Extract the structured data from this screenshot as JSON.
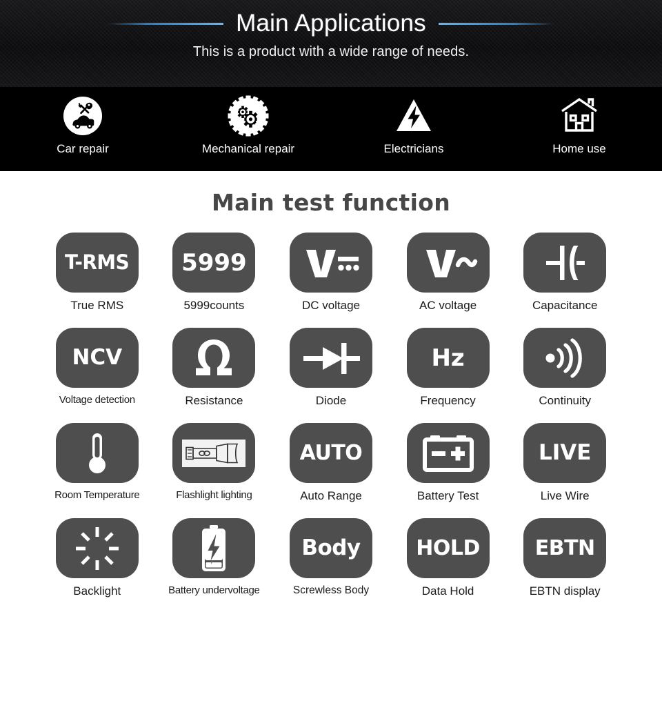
{
  "hero": {
    "title": "Main Applications",
    "subtitle": "This is a product with a wide range of needs.",
    "accent_color": "#4aa3e8",
    "background_color": "#111113"
  },
  "applications": {
    "background_color": "#000000",
    "items": [
      {
        "label": "Car repair",
        "icon": "car-repair-icon"
      },
      {
        "label": "Mechanical repair",
        "icon": "gears-icon"
      },
      {
        "label": "Electricians",
        "icon": "high-voltage-triangle-icon"
      },
      {
        "label": "Home use",
        "icon": "house-icon"
      }
    ]
  },
  "functions": {
    "title": "Main test function",
    "tile_color": "#4e4e4e",
    "tile_glyph_color": "#ffffff",
    "label_color": "#1b1b1b",
    "items": [
      {
        "label": "True RMS",
        "glyph": "T-RMS",
        "icon": "t-rms-text-icon"
      },
      {
        "label": "5999counts",
        "glyph": "5999",
        "icon": "5999-text-icon"
      },
      {
        "label": "DC voltage",
        "glyph": "V",
        "icon": "dc-voltage-icon"
      },
      {
        "label": "AC voltage",
        "glyph": "V~",
        "icon": "ac-voltage-icon"
      },
      {
        "label": "Capacitance",
        "glyph": "",
        "icon": "capacitor-icon"
      },
      {
        "label": "Voltage detection",
        "glyph": "NCV",
        "icon": "ncv-text-icon"
      },
      {
        "label": "Resistance",
        "glyph": "Ω",
        "icon": "omega-icon"
      },
      {
        "label": "Diode",
        "glyph": "",
        "icon": "diode-icon"
      },
      {
        "label": "Frequency",
        "glyph": "Hz",
        "icon": "hz-text-icon"
      },
      {
        "label": "Continuity",
        "glyph": "",
        "icon": "buzzer-wave-icon"
      },
      {
        "label": "Room Temperature",
        "glyph": "",
        "icon": "thermometer-icon"
      },
      {
        "label": "Flashlight lighting",
        "glyph": "",
        "icon": "flashlight-icon"
      },
      {
        "label": "Auto Range",
        "glyph": "AUTO",
        "icon": "auto-text-icon"
      },
      {
        "label": "Battery Test",
        "glyph": "",
        "icon": "car-battery-icon"
      },
      {
        "label": "Live Wire",
        "glyph": "LIVE",
        "icon": "live-text-icon"
      },
      {
        "label": "Backlight",
        "glyph": "",
        "icon": "backlight-rays-icon"
      },
      {
        "label": "Battery undervoltage",
        "glyph": "",
        "icon": "battery-bolt-icon"
      },
      {
        "label": "Screwless Body",
        "glyph": "Body",
        "icon": "body-text-icon"
      },
      {
        "label": "Data Hold",
        "glyph": "HOLD",
        "icon": "hold-text-icon"
      },
      {
        "label": "EBTN display",
        "glyph": "EBTN",
        "icon": "ebtn-text-icon"
      }
    ]
  }
}
